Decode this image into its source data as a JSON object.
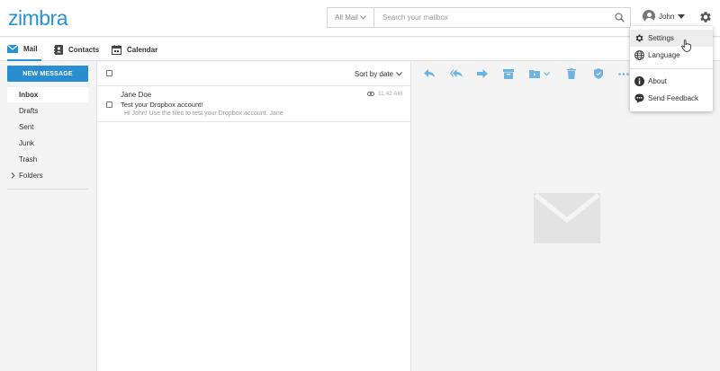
{
  "app": {
    "logo": "zimbra"
  },
  "search": {
    "scope": "All Mail",
    "placeholder": "Search your mailbox"
  },
  "user": {
    "name": "John"
  },
  "tabs": [
    {
      "label": "Mail",
      "icon": "envelope-icon",
      "active": true
    },
    {
      "label": "Contacts",
      "icon": "contacts-book-icon",
      "active": false
    },
    {
      "label": "Calendar",
      "icon": "calendar-icon",
      "active": false
    }
  ],
  "sidebar": {
    "new_message": "NEW MESSAGE",
    "folders": [
      "Inbox",
      "Drafts",
      "Sent",
      "Junk",
      "Trash"
    ],
    "active_folder": "Inbox",
    "folders_group": "Folders"
  },
  "list": {
    "sort_label": "Sort by date",
    "messages": [
      {
        "from": "Jane Doe",
        "subject": "Test your Dropbox account!",
        "preview": "Hi John!  Use the files to test your Dropbox account.   Jane",
        "time": "11:42 AM",
        "has_attachment": true
      }
    ]
  },
  "toolbar": {
    "icons": [
      "reply-icon",
      "reply-all-icon",
      "forward-icon",
      "archive-icon",
      "move-to-folder-icon",
      "delete-icon",
      "spam-shield-icon",
      "more-icon"
    ]
  },
  "menu": {
    "items": [
      {
        "label": "Settings",
        "icon": "gear-icon",
        "hover": true
      },
      {
        "label": "Language",
        "icon": "globe-icon"
      },
      {
        "label": "About",
        "icon": "info-icon"
      },
      {
        "label": "Send Feedback",
        "icon": "feedback-icon"
      }
    ]
  },
  "colors": {
    "accent": "#2a93d5",
    "button": "#2a8dd0",
    "toolbar_icon": "#6fb3e0"
  }
}
